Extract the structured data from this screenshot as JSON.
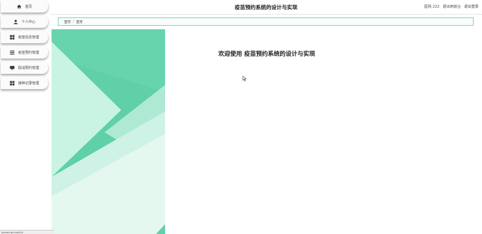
{
  "header": {
    "title": "疫苗预约系统的设计与实现",
    "user_label": "医院 222",
    "back_to_front": "退出到前台",
    "logout": "退出登录"
  },
  "sidebar": {
    "items": [
      {
        "label": "首页",
        "icon": "home-icon"
      },
      {
        "label": "个人中心",
        "icon": "user-icon"
      },
      {
        "label": "疫苗信息管理",
        "icon": "grid-icon"
      },
      {
        "label": "疫苗预约管理",
        "icon": "list-icon"
      },
      {
        "label": "取消预约管理",
        "icon": "monitor-icon"
      },
      {
        "label": "接种记录管理",
        "icon": "grid-icon"
      }
    ]
  },
  "breadcrumb": {
    "items": [
      "首页",
      "首页"
    ],
    "separator": "/"
  },
  "main": {
    "welcome": "欢迎使用 疫苗预约系统的设计与实现"
  },
  "statusbar": {
    "text": "javascript:void(0)"
  },
  "colors": {
    "accent": "#5fd0a8",
    "accent_light": "#c6f3e2",
    "breadcrumb_border": "#7fd8b5"
  }
}
